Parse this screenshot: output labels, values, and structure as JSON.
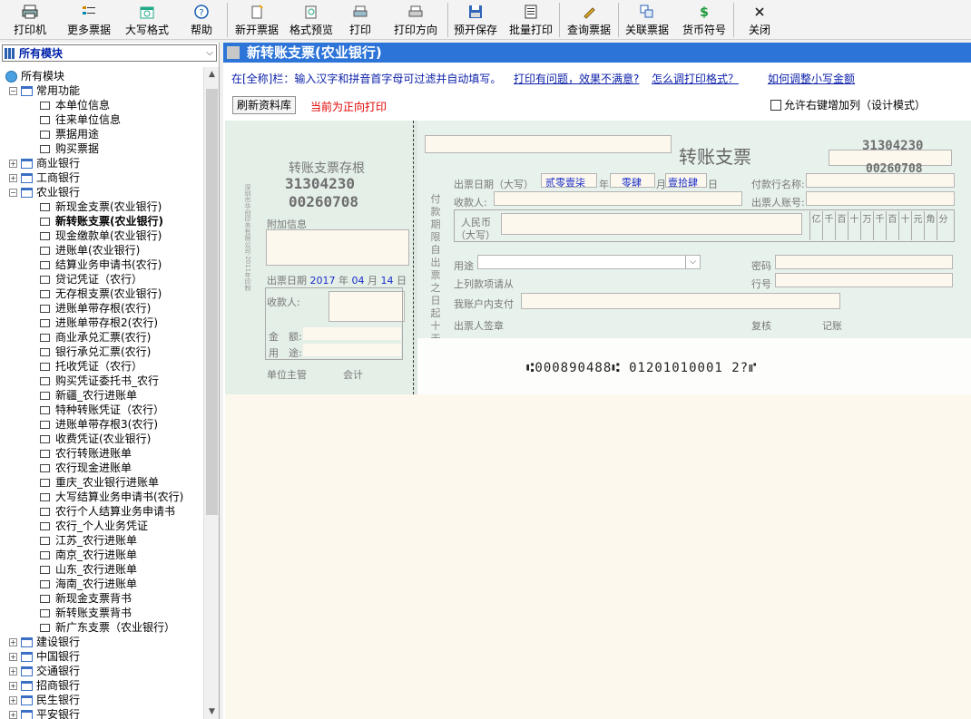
{
  "toolbar": {
    "printer": "打印机",
    "more": "更多票据",
    "bigformat": "大写格式",
    "help": "帮助",
    "newbill": "新开票据",
    "preview": "格式预览",
    "print": "打印",
    "direction": "打印方向",
    "presave": "预开保存",
    "batch": "批量打印",
    "query": "查询票据",
    "related": "关联票据",
    "currency": "货币符号",
    "close": "关闭"
  },
  "left": {
    "selector": "所有模块",
    "tree": {
      "root": "所有模块",
      "common": "常用功能",
      "common_items": [
        "本单位信息",
        "往来单位信息",
        "票据用途",
        "购买票据"
      ],
      "commercial": "商业银行",
      "icbc": "工商银行",
      "abc": "农业银行",
      "abc_items": [
        "新现金支票(农业银行)",
        "新转账支票(农业银行)",
        "现金缴款单(农业银行)",
        "进账单(农业银行)",
        "结算业务申请书(农行)",
        "贷记凭证（农行）",
        "无存根支票(农业银行)",
        "进账单带存根(农行)",
        "进账单带存根2(农行)",
        "商业承兑汇票(农行)",
        "银行承兑汇票(农行)",
        "托收凭证（农行）",
        "购买凭证委托书_农行",
        "新疆_农行进账单",
        "特种转账凭证（农行）",
        "进账单带存根3(农行)",
        "收费凭证(农业银行)",
        "农行转账进账单",
        "农行现金进账单",
        "重庆_农业银行进账单",
        "大写结算业务申请书(农行)",
        "农行个人结算业务申请书",
        "农行_个人业务凭证",
        "江苏_农行进账单",
        "南京_农行进账单",
        "山东_农行进账单",
        "海南_农行进账单",
        "新现金支票背书",
        "新转账支票背书",
        "新广东支票（农业银行）"
      ],
      "ccb": "建设银行",
      "boc": "中国银行",
      "bocom": "交通银行",
      "cmb": "招商银行",
      "cmbc": "民生银行",
      "pingan": "平安银行"
    }
  },
  "right": {
    "title": "新转账支票(农业银行)",
    "hint": "在[全称]栏：输入汉字和拼音首字母可过滤并自动填写。",
    "link1": "打印有问题，效果不满意?",
    "link2": "怎么调打印格式？",
    "link3": "如何调整小写金额",
    "refresh": "刷新资料库",
    "direction_status": "当前为正向打印",
    "allow": "允许右键增加列（设计模式）",
    "stub": {
      "title": "转账支票存根",
      "code1": "31304230",
      "code2": "00260708",
      "attach": "附加信息",
      "date_label": "出票日期",
      "year": "2017",
      "y_unit": "年",
      "month": "04",
      "m_unit": "月",
      "day": "14",
      "d_unit": "日",
      "payee": "收款人:",
      "amount": "金　额:",
      "usage": "用　途:",
      "manager": "单位主管",
      "accountant": "会计",
      "printer_text": "深圳市华创印务有限公司·2011年印制"
    },
    "main": {
      "title": "转账支票",
      "code1": "31304230",
      "code2": "00260708",
      "date_label": "出票日期（大写）",
      "year_val": "贰零壹柒",
      "year_unit": "年",
      "month_val": "零肆",
      "month_unit": "月",
      "day_val": "壹拾肆",
      "day_unit": "日",
      "bank_name": "付款行名称:",
      "payee": "收款人:",
      "account": "出票人账号:",
      "rmb": "人民币",
      "daxie": "（大写）",
      "digits": [
        "亿",
        "千",
        "百",
        "十",
        "万",
        "千",
        "百",
        "十",
        "元",
        "角",
        "分"
      ],
      "vertical": "付款期限自出票之日起十天",
      "usage": "用途",
      "password": "密码",
      "bank_no": "行号",
      "above": "上列款项请从",
      "mine": "我账户内支付",
      "signer": "出票人签章",
      "review": "复核",
      "record": "记账",
      "micr": "⑆000890488⑆ 01201010001 2?⑈"
    }
  }
}
